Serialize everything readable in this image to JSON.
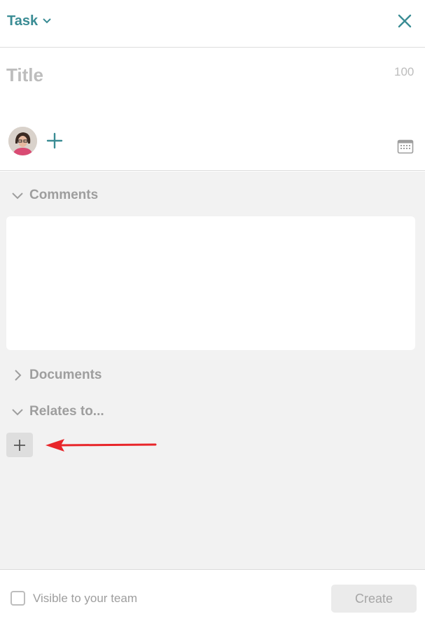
{
  "header": {
    "type_label": "Task"
  },
  "task": {
    "title_placeholder": "Title",
    "char_count": "100"
  },
  "sections": {
    "comments_label": "Comments",
    "documents_label": "Documents",
    "relates_label": "Relates to..."
  },
  "footer": {
    "visible_label": "Visible to your team",
    "create_label": "Create"
  },
  "icons": {
    "close": "close-icon",
    "chevron_down": "chevron-down-icon",
    "chevron_right": "chevron-right-icon",
    "plus": "plus-icon",
    "calendar": "calendar-icon"
  },
  "colors": {
    "accent": "#3a8c94",
    "annotation_arrow": "#e8262a",
    "panel_bg": "#f2f2f2"
  }
}
